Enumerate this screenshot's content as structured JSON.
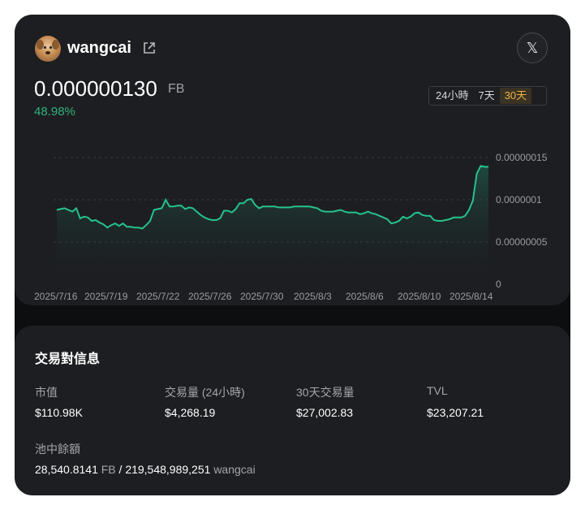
{
  "token": {
    "name": "wangcai",
    "price": "0.000000130",
    "price_unit": "FB",
    "change": "48.98%"
  },
  "icons": {
    "avatar": "dog-avatar",
    "external": "external-link-icon",
    "social": "x-logo-icon",
    "x_glyph": "𝕏"
  },
  "range_tabs": [
    {
      "label": "24小時",
      "active": false
    },
    {
      "label": "7天",
      "active": false
    },
    {
      "label": "30天",
      "active": true
    }
  ],
  "colors": {
    "positive": "#2fb37a",
    "line": "#26c28c",
    "active_tab": "#f0b24a"
  },
  "chart_data": {
    "type": "area",
    "x_ticks": [
      "2025/7/16",
      "2025/7/19",
      "2025/7/22",
      "2025/7/26",
      "2025/7/30",
      "2025/8/3",
      "2025/8/6",
      "2025/8/10",
      "2025/8/14"
    ],
    "y_ticks": [
      "0.00000015",
      "0.0000001",
      "0.00000005",
      "0"
    ],
    "ylim": [
      0,
      1.5e-07
    ],
    "grid": true,
    "values": [
      8.8e-08,
      8.9e-08,
      9e-08,
      8.8e-08,
      8.6e-08,
      9e-08,
      7.8e-08,
      8e-08,
      7.9e-08,
      7.5e-08,
      7.6e-08,
      7.3e-08,
      7.1e-08,
      6.7e-08,
      7e-08,
      7.2e-08,
      6.9e-08,
      7.2e-08,
      6.8e-08,
      6.8e-08,
      6.7e-08,
      6.7e-08,
      6.6e-08,
      7e-08,
      7.5e-08,
      8.8e-08,
      8.9e-08,
      9e-08,
      1e-07,
      9.2e-08,
      9.2e-08,
      9.3e-08,
      9.3e-08,
      8.9e-08,
      9.1e-08,
      9e-08,
      8.6e-08,
      8.2e-08,
      7.9e-08,
      7.7e-08,
      7.6e-08,
      7.6e-08,
      7.8e-08,
      8.7e-08,
      8.7e-08,
      8.5e-08,
      8.9e-08,
      9.6e-08,
      9.6e-08,
      1e-07,
      1.01e-07,
      9.4e-08,
      9e-08,
      9.2e-08,
      9.2e-08,
      9.2e-08,
      9.2e-08,
      9.1e-08,
      9.1e-08,
      9.1e-08,
      9.1e-08,
      9.2e-08,
      9.2e-08,
      9.2e-08,
      9.2e-08,
      9.2e-08,
      9.1e-08,
      9e-08,
      8.7e-08,
      8.6e-08,
      8.6e-08,
      8.6e-08,
      8.7e-08,
      8.8e-08,
      8.6e-08,
      8.5e-08,
      8.5e-08,
      8.5e-08,
      8.3e-08,
      8.4e-08,
      8.6e-08,
      8.4e-08,
      8.3e-08,
      8.1e-08,
      7.9e-08,
      7.7e-08,
      7.2e-08,
      7.3e-08,
      7.5e-08,
      8e-08,
      7.8e-08,
      8e-08,
      8.4e-08,
      8.5e-08,
      8.2e-08,
      8.1e-08,
      8.1e-08,
      7.6e-08,
      7.5e-08,
      7.5e-08,
      7.6e-08,
      7.7e-08,
      7.9e-08,
      7.9e-08,
      7.9e-08,
      8.1e-08,
      8.8e-08,
      9.9e-08,
      1.31e-07,
      1.4e-07,
      1.39e-07,
      1.39e-07
    ]
  },
  "trade_info": {
    "title": "交易對信息",
    "market_cap_label": "市值",
    "market_cap": "$110.98K",
    "volume_24h_label": "交易量 (24小時)",
    "volume_24h": "$4,268.19",
    "volume_30d_label": "30天交易量",
    "volume_30d": "$27,002.83",
    "tvl_label": "TVL",
    "tvl": "$23,207.21",
    "pool_label": "池中餘額",
    "pool_amount_a": "28,540.8141",
    "pool_symbol_a": "FB",
    "pool_separator": "/",
    "pool_amount_b": "219,548,989,251",
    "pool_symbol_b": "wangcai"
  }
}
